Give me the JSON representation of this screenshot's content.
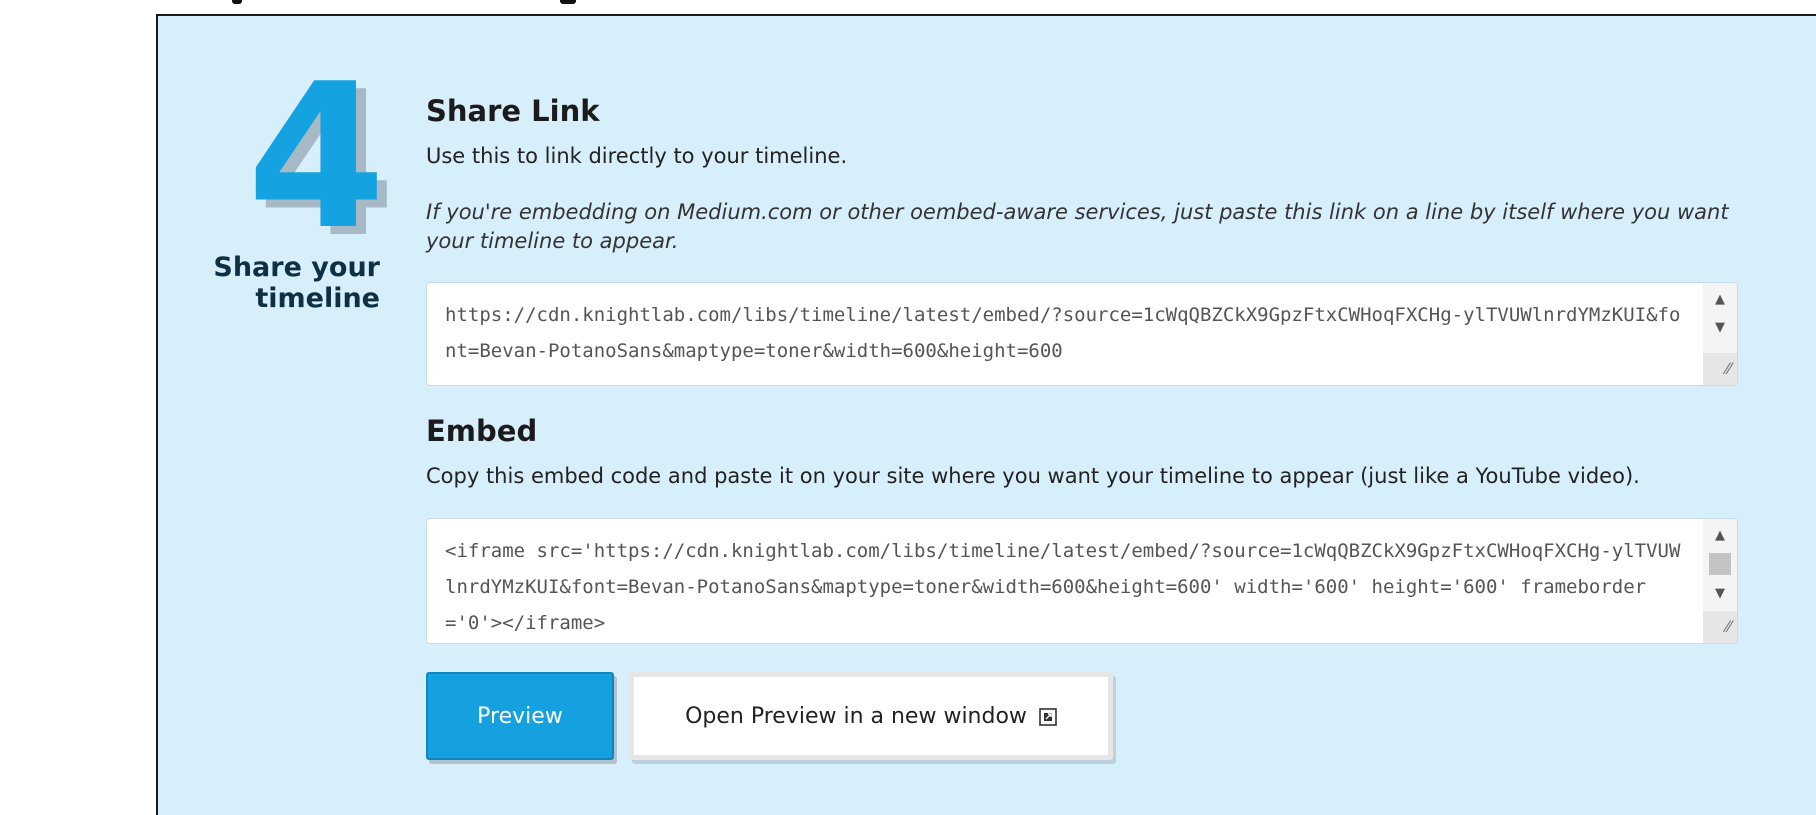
{
  "step": {
    "number": "4",
    "title_line1": "Share your",
    "title_line2": "timeline"
  },
  "share_link": {
    "heading": "Share Link",
    "description": "Use this to link directly to your timeline.",
    "note": "If you're embedding on Medium.com or other oembed-aware services, just paste this link on a line by itself where you want your timeline to appear.",
    "url": "https://cdn.knightlab.com/libs/timeline/latest/embed/?source=1cWqQBZCkX9GpzFtxCWHoqFXCHg-ylTVUWlnrdYMzKUI&font=Bevan-PotanoSans&maptype=toner&width=600&height=600"
  },
  "embed": {
    "heading": "Embed",
    "description": "Copy this embed code and paste it on your site where you want your timeline to appear (just like a YouTube video).",
    "code": "<iframe src='https://cdn.knightlab.com/libs/timeline/latest/embed/?source=1cWqQBZCkX9GpzFtxCWHoqFXCHg-ylTVUWlnrdYMzKUI&font=Bevan-PotanoSans&maptype=toner&width=600&height=600' width='600' height='600' frameborder='0'></iframe>"
  },
  "buttons": {
    "preview_label": "Preview",
    "open_preview_label": "Open Preview in a new window",
    "open_preview_icon": "external-link-icon"
  },
  "colors": {
    "panel_background": "#d7eefb",
    "accent": "#14a2e0",
    "step_title": "#0f2f44"
  }
}
